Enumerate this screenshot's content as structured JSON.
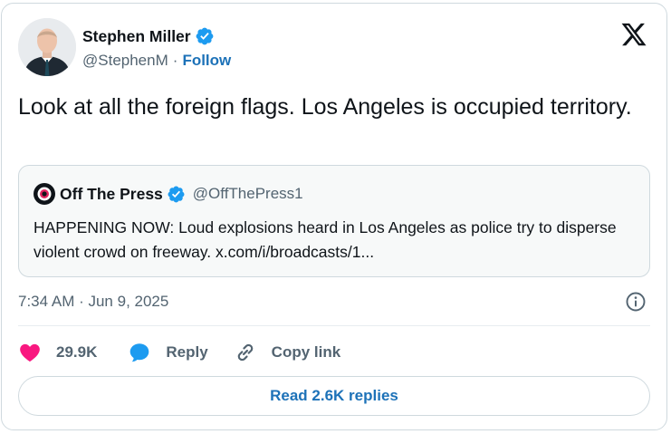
{
  "author": {
    "name": "Stephen Miller",
    "handle": "@StephenM",
    "separator": "·",
    "follow_label": "Follow"
  },
  "tweet": {
    "text": "Look at all the foreign flags. Los Angeles is occupied territory.",
    "timestamp": "7:34 AM · Jun 9, 2025"
  },
  "quoted": {
    "name": "Off The Press",
    "handle": "@OffThePress1",
    "text": "HAPPENING NOW: Loud explosions heard in Los Angeles as police try to disperse violent crowd on freeway. x.com/i/broadcasts/1..."
  },
  "actions": {
    "likes": "29.9K",
    "reply_label": "Reply",
    "copy_link_label": "Copy link"
  },
  "read_replies_label": "Read 2.6K replies",
  "icons": {
    "verified": "verified-badge-icon",
    "x_logo": "x-logo-icon",
    "info": "info-icon",
    "heart": "heart-icon",
    "reply": "reply-bubble-icon",
    "link": "link-icon"
  },
  "colors": {
    "accent": "#1d9bf0",
    "link": "#1d72b8",
    "like": "#f91880",
    "secondary_text": "#536471",
    "border": "#cfd9de"
  }
}
